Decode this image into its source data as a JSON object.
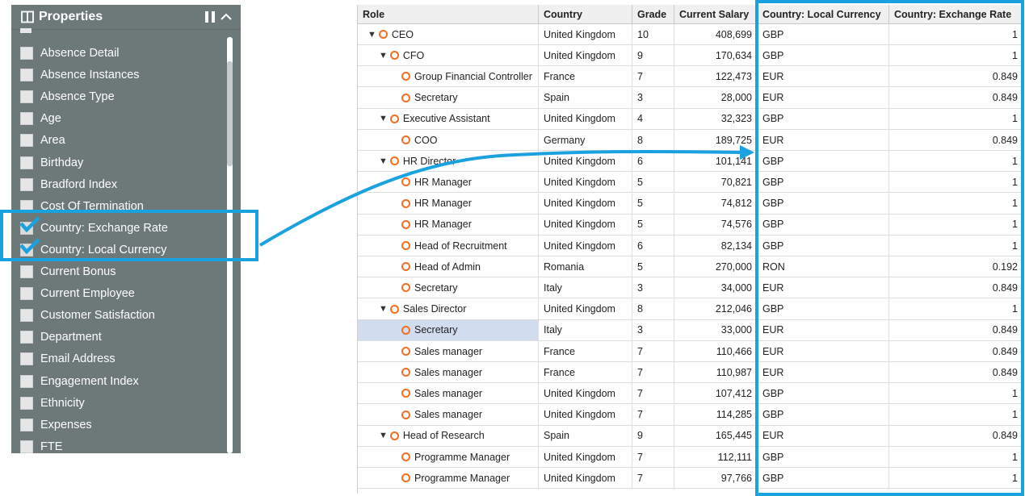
{
  "panel": {
    "title": "Properties",
    "items": [
      {
        "label": "Absence Detail",
        "checked": false
      },
      {
        "label": "Absence Instances",
        "checked": false
      },
      {
        "label": "Absence Type",
        "checked": false
      },
      {
        "label": "Age",
        "checked": false
      },
      {
        "label": "Area",
        "checked": false
      },
      {
        "label": "Birthday",
        "checked": false
      },
      {
        "label": "Bradford Index",
        "checked": false
      },
      {
        "label": "Cost Of Termination",
        "checked": false
      },
      {
        "label": "Country: Exchange Rate",
        "checked": true
      },
      {
        "label": "Country: Local Currency",
        "checked": true
      },
      {
        "label": "Current Bonus",
        "checked": false
      },
      {
        "label": "Current Employee",
        "checked": false
      },
      {
        "label": "Customer Satisfaction",
        "checked": false
      },
      {
        "label": "Department",
        "checked": false
      },
      {
        "label": "Email Address",
        "checked": false
      },
      {
        "label": "Engagement Index",
        "checked": false
      },
      {
        "label": "Ethnicity",
        "checked": false
      },
      {
        "label": "Expenses",
        "checked": false
      },
      {
        "label": "FTE",
        "checked": false
      }
    ]
  },
  "table": {
    "columns": [
      "Role",
      "Country",
      "Grade",
      "Current Salary",
      "Country: Local Currency",
      "Country: Exchange Rate"
    ],
    "rows": [
      {
        "role": "CEO",
        "level": 0,
        "toggle": true,
        "country": "United Kingdom",
        "grade": "10",
        "salary": "408,699",
        "currency": "GBP",
        "rate": "1"
      },
      {
        "role": "CFO",
        "level": 1,
        "toggle": true,
        "country": "United Kingdom",
        "grade": "9",
        "salary": "170,634",
        "currency": "GBP",
        "rate": "1"
      },
      {
        "role": "Group Financial Controller",
        "level": 2,
        "toggle": false,
        "country": "France",
        "grade": "7",
        "salary": "122,473",
        "currency": "EUR",
        "rate": "0.849"
      },
      {
        "role": "Secretary",
        "level": 2,
        "toggle": false,
        "country": "Spain",
        "grade": "3",
        "salary": "28,000",
        "currency": "EUR",
        "rate": "0.849"
      },
      {
        "role": "Executive Assistant",
        "level": 1,
        "toggle": true,
        "country": "United Kingdom",
        "grade": "4",
        "salary": "32,323",
        "currency": "GBP",
        "rate": "1"
      },
      {
        "role": "COO",
        "level": 2,
        "toggle": false,
        "country": "Germany",
        "grade": "8",
        "salary": "189,725",
        "currency": "EUR",
        "rate": "0.849"
      },
      {
        "role": "HR Director",
        "level": 1,
        "toggle": true,
        "country": "United Kingdom",
        "grade": "6",
        "salary": "101,141",
        "currency": "GBP",
        "rate": "1"
      },
      {
        "role": "HR Manager",
        "level": 2,
        "toggle": false,
        "country": "United Kingdom",
        "grade": "5",
        "salary": "70,821",
        "currency": "GBP",
        "rate": "1"
      },
      {
        "role": "HR Manager",
        "level": 2,
        "toggle": false,
        "country": "United Kingdom",
        "grade": "5",
        "salary": "74,812",
        "currency": "GBP",
        "rate": "1"
      },
      {
        "role": "HR Manager",
        "level": 2,
        "toggle": false,
        "country": "United Kingdom",
        "grade": "5",
        "salary": "74,576",
        "currency": "GBP",
        "rate": "1"
      },
      {
        "role": "Head of Recruitment",
        "level": 2,
        "toggle": false,
        "country": "United Kingdom",
        "grade": "6",
        "salary": "82,134",
        "currency": "GBP",
        "rate": "1"
      },
      {
        "role": "Head of Admin",
        "level": 2,
        "toggle": false,
        "country": "Romania",
        "grade": "5",
        "salary": "270,000",
        "currency": "RON",
        "rate": "0.192"
      },
      {
        "role": "Secretary",
        "level": 2,
        "toggle": false,
        "country": "Italy",
        "grade": "3",
        "salary": "34,000",
        "currency": "EUR",
        "rate": "0.849"
      },
      {
        "role": "Sales Director",
        "level": 1,
        "toggle": true,
        "country": "United Kingdom",
        "grade": "8",
        "salary": "212,046",
        "currency": "GBP",
        "rate": "1"
      },
      {
        "role": "Secretary",
        "level": 2,
        "toggle": false,
        "country": "Italy",
        "grade": "3",
        "salary": "33,000",
        "currency": "EUR",
        "rate": "0.849",
        "selected": true
      },
      {
        "role": "Sales manager",
        "level": 2,
        "toggle": false,
        "country": "France",
        "grade": "7",
        "salary": "110,466",
        "currency": "EUR",
        "rate": "0.849"
      },
      {
        "role": "Sales manager",
        "level": 2,
        "toggle": false,
        "country": "France",
        "grade": "7",
        "salary": "110,987",
        "currency": "EUR",
        "rate": "0.849"
      },
      {
        "role": "Sales manager",
        "level": 2,
        "toggle": false,
        "country": "United Kingdom",
        "grade": "7",
        "salary": "107,412",
        "currency": "GBP",
        "rate": "1"
      },
      {
        "role": "Sales manager",
        "level": 2,
        "toggle": false,
        "country": "United Kingdom",
        "grade": "7",
        "salary": "114,285",
        "currency": "GBP",
        "rate": "1"
      },
      {
        "role": "Head of Research",
        "level": 1,
        "toggle": true,
        "country": "Spain",
        "grade": "9",
        "salary": "165,445",
        "currency": "EUR",
        "rate": "0.849"
      },
      {
        "role": "Programme Manager",
        "level": 2,
        "toggle": false,
        "country": "United Kingdom",
        "grade": "7",
        "salary": "112,111",
        "currency": "GBP",
        "rate": "1"
      },
      {
        "role": "Programme Manager",
        "level": 2,
        "toggle": false,
        "country": "United Kingdom",
        "grade": "7",
        "salary": "97,766",
        "currency": "GBP",
        "rate": "1"
      }
    ]
  },
  "colors": {
    "accent": "#1aa1e0",
    "panel_bg": "#6d7978",
    "node": "#f36f21",
    "selected_row": "#d2dcef"
  },
  "icons": {
    "panel": "panel-layout-icon",
    "pause": "pause-icon",
    "collapse": "chevron-up-icon",
    "expand": "triangle-down-icon",
    "node": "circle-node-icon",
    "check": "check-icon"
  }
}
